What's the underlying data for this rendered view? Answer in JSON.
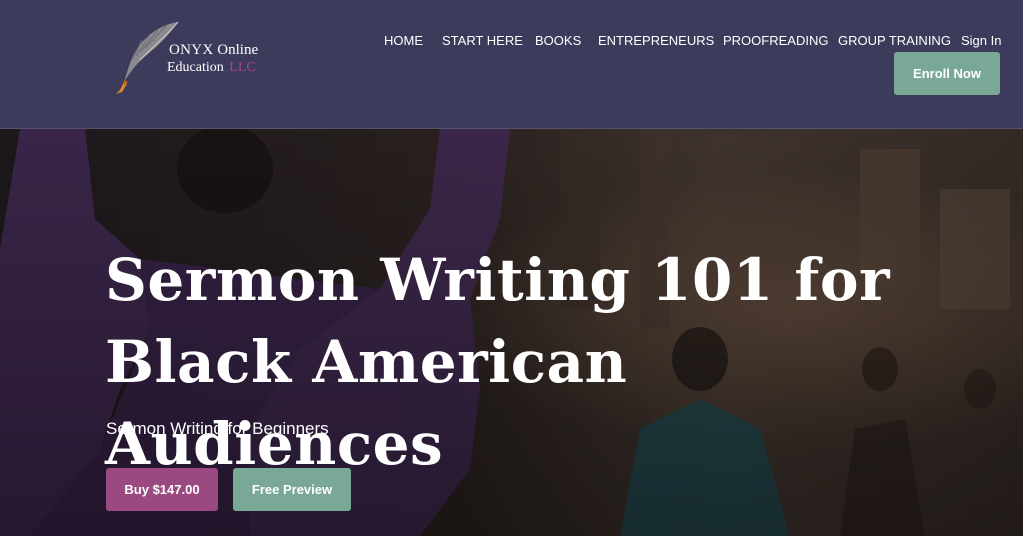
{
  "logo": {
    "brand": "ONYX",
    "line1_rest": "Online",
    "line2": "Education",
    "llc": "LLC",
    "icon": "quill-pen-icon"
  },
  "nav": {
    "items": [
      "HOME",
      "START HERE",
      "BOOKS",
      "ENTREPRENEURS",
      "PROOFREADING",
      "GROUP TRAINING"
    ],
    "sign_in": "Sign In",
    "enroll": "Enroll Now"
  },
  "hero": {
    "title": "Sermon Writing 101 for Black American Audiences",
    "subtitle": "Sermon Writing for Beginners",
    "buy_label": "Buy $147.00",
    "preview_label": "Free Preview"
  },
  "colors": {
    "header_bg": "#3c3b5c",
    "buy_button": "#9a4a80",
    "green_button": "#7aa897",
    "llc_accent": "#a7448f"
  }
}
